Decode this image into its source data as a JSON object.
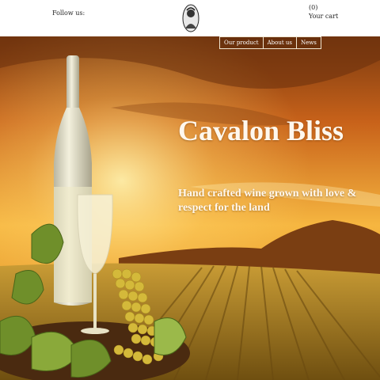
{
  "header": {
    "follow_label": "Follow us:",
    "cart_count": "(0)",
    "cart_label": "Your cart",
    "logo_icon": "bust-logo-icon"
  },
  "nav": {
    "items": [
      "Our product",
      "About us",
      "News"
    ]
  },
  "hero": {
    "title": "Cavalon Bliss",
    "tagline": "Hand crafted wine grown with love & respect for the land"
  },
  "colors": {
    "sky_top": "#7a3a10",
    "sky_glow": "#f6b640",
    "field": "#b2861f",
    "text": "#fff8ee"
  }
}
